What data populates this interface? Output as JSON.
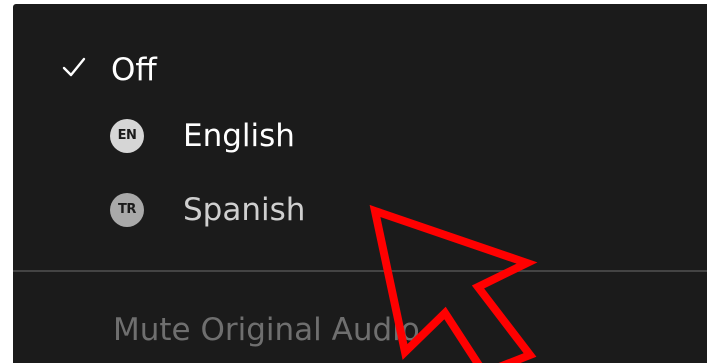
{
  "menu": {
    "items": [
      {
        "label": "Off",
        "selected": true,
        "icon": "checkmark-icon"
      },
      {
        "label": "English",
        "badge": "EN",
        "selected": false,
        "icon": "language-badge-icon"
      },
      {
        "label": "Spanish",
        "badge": "TR",
        "selected": false,
        "icon": "language-badge-icon"
      }
    ],
    "mute_label": "Mute Original Audio"
  },
  "annotation": {
    "pointer_icon": "red-arrow-pointer-icon",
    "color": "#ff0000"
  },
  "colors": {
    "menu_background": "#1b1b1b",
    "text_primary": "#ffffff",
    "text_secondary": "#cfcfcf",
    "text_disabled": "#6f6f6f"
  }
}
